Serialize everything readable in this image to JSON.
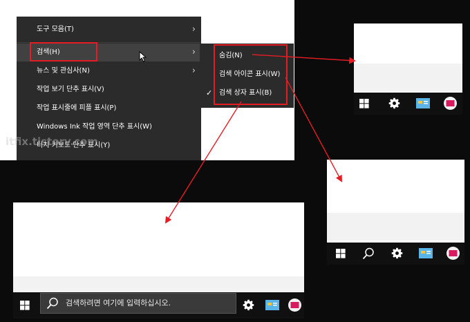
{
  "context_menu": {
    "items": [
      {
        "label": "도구 모음(T)",
        "submenu": true
      },
      {
        "label": "검색(H)",
        "submenu": true,
        "highlighted": true
      },
      {
        "label": "뉴스 및 관심사(N)",
        "submenu": true
      },
      {
        "label": "작업 보기 단추 표시(V)",
        "submenu": false
      },
      {
        "label": "작업 표시줄에 피플 표시(P)",
        "submenu": false
      },
      {
        "label": "Windows Ink 작업 영역 단추 표시(W)",
        "submenu": false
      },
      {
        "label": "터치 키보드 단추 표시(Y)",
        "submenu": false
      }
    ]
  },
  "search_submenu": {
    "items": [
      {
        "label": "숨김(N)",
        "checked": false
      },
      {
        "label": "검색 아이콘 표시(W)",
        "checked": false
      },
      {
        "label": "검색 상자 표시(B)",
        "checked": true
      }
    ],
    "check_glyph": "✓"
  },
  "taskbar_search_box": {
    "placeholder": "검색하려면 여기에 입력하십시오."
  },
  "watermark": "itfix.tistory.com",
  "colors": {
    "accent_red": "#e51c23",
    "menu_bg": "#2b2b2b",
    "taskbar_bg": "#101010"
  },
  "icons": [
    "chevron-right-icon",
    "cursor-icon",
    "windows-start-icon",
    "search-icon",
    "gear-icon",
    "news-icon",
    "people-icon"
  ]
}
